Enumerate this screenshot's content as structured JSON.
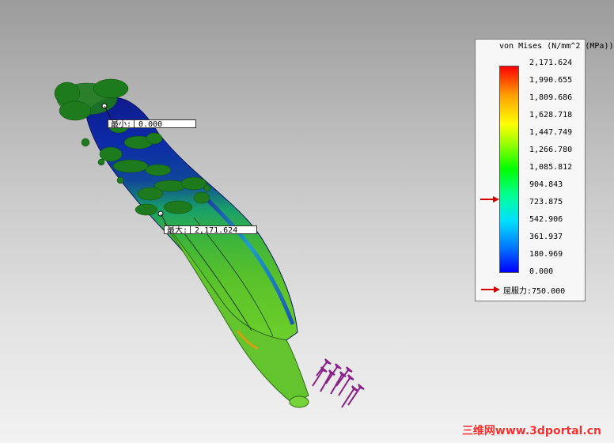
{
  "plot": {
    "title": "von Mises (N/mm^2 (MPa))",
    "ticks": [
      "2,171.624",
      "1,990.655",
      "1,809.686",
      "1,628.718",
      "1,447.749",
      "1,266.780",
      "1,085.812",
      "904.843",
      "723.875",
      "542.906",
      "361.937",
      "180.969",
      "0.000"
    ],
    "yield_label": "屈服力:750.000",
    "yield_value": 750.0,
    "range": [
      0.0,
      2171.624
    ],
    "colors": {
      "low": "#0000ff",
      "high": "#ff0000",
      "marker": "#d40000",
      "fixture": "#1d7a1d",
      "load": "#8a1f8a"
    }
  },
  "probes": {
    "min": {
      "label": "最小:",
      "value": "0.000"
    },
    "max": {
      "label": "最大:",
      "value": "2,171.624"
    }
  },
  "watermark": "三维网www.3dportal.cn"
}
